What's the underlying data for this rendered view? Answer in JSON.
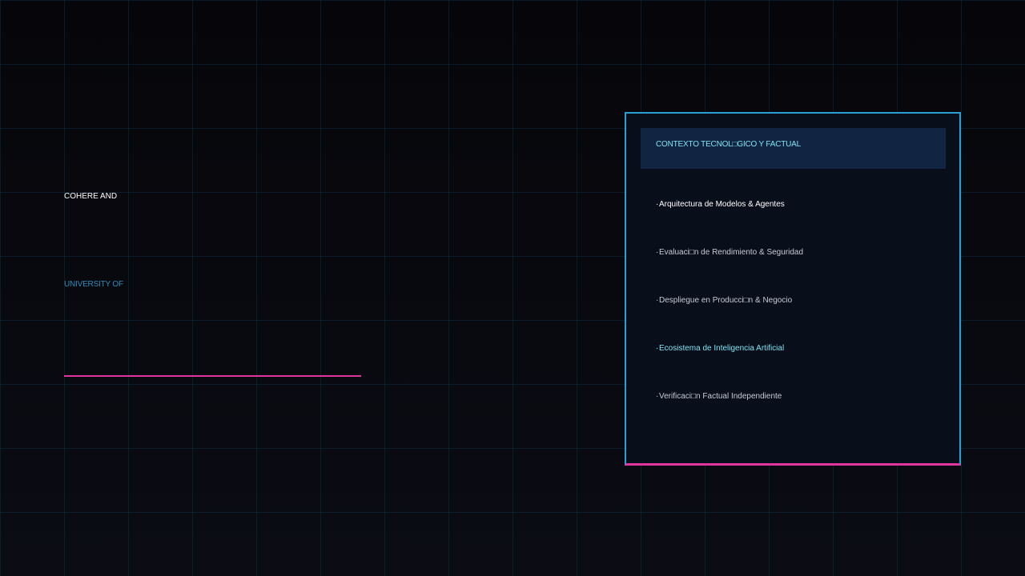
{
  "colors": {
    "background": "#07070b",
    "grid": "#122a3a",
    "accent_cyan": "#2a9fd4",
    "accent_magenta": "#e0359f",
    "highlight_text": "#7fe3f2"
  },
  "left": {
    "title": "COHERE AND",
    "subtitle": "UNIVERSITY OF"
  },
  "panel": {
    "header": "CONTEXTO TECNOL□GICO Y FACTUAL",
    "items": [
      {
        "bullet": "·",
        "label": "Arquitectura de Modelos & Agentes"
      },
      {
        "bullet": "·",
        "label": "Evaluaci□n de Rendimiento & Seguridad"
      },
      {
        "bullet": "·",
        "label": "Despliegue en Producci□n & Negocio"
      },
      {
        "bullet": "·",
        "label": "Ecosistema de Inteligencia Artificial"
      },
      {
        "bullet": "·",
        "label": "Verificaci□n Factual Independiente"
      }
    ]
  }
}
